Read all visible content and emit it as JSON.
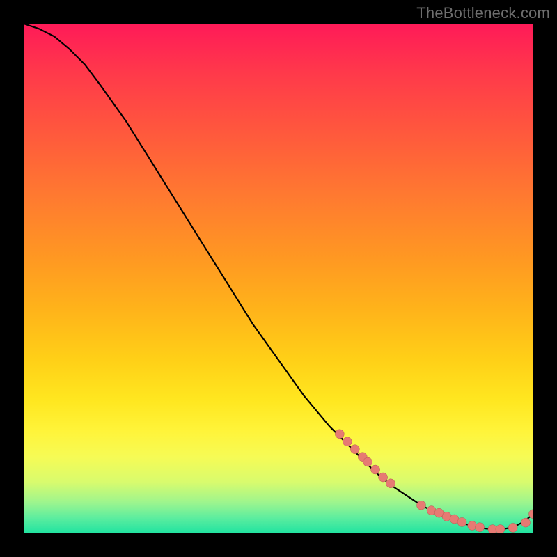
{
  "watermark": "TheBottleneck.com",
  "colors": {
    "curve_stroke": "#000000",
    "marker_fill": "#e67a73",
    "marker_stroke": "#b55850",
    "background": "#000000"
  },
  "chart_data": {
    "type": "line",
    "title": "",
    "xlabel": "",
    "ylabel": "",
    "xlim": [
      0,
      100
    ],
    "ylim": [
      0,
      100
    ],
    "grid": false,
    "legend": false,
    "series": [
      {
        "name": "bottleneck-curve",
        "comment": "Values read as approximate percentages of plot width (x) and plot height (y), origin at bottom-left.",
        "x": [
          0,
          3,
          6,
          9,
          12,
          15,
          20,
          25,
          30,
          35,
          40,
          45,
          50,
          55,
          60,
          63,
          66,
          69,
          72,
          75,
          78,
          80,
          82,
          84,
          86,
          88,
          90,
          92,
          94,
          96,
          98,
          100
        ],
        "y": [
          100,
          99,
          97.5,
          95,
          92,
          88,
          81,
          73,
          65,
          57,
          49,
          41,
          34,
          27,
          21,
          18,
          15,
          12,
          9.5,
          7.5,
          5.5,
          4.5,
          3.5,
          2.8,
          2,
          1.5,
          1,
          0.8,
          0.8,
          1.2,
          2.2,
          3.8
        ]
      }
    ],
    "markers": {
      "comment": "Salmon dots along the lower-right tail where the curve flattens and turns up.",
      "x": [
        62,
        63.5,
        65,
        66.5,
        67.5,
        69,
        70.5,
        72,
        78,
        80,
        81.5,
        83,
        84.5,
        86,
        88,
        89.5,
        92,
        93.5,
        96,
        98.5,
        100
      ],
      "y": [
        19.5,
        18,
        16.5,
        15,
        14,
        12.5,
        11,
        9.8,
        5.5,
        4.5,
        4,
        3.3,
        2.8,
        2.2,
        1.5,
        1.2,
        0.8,
        0.8,
        1.1,
        2.1,
        3.8
      ]
    }
  }
}
